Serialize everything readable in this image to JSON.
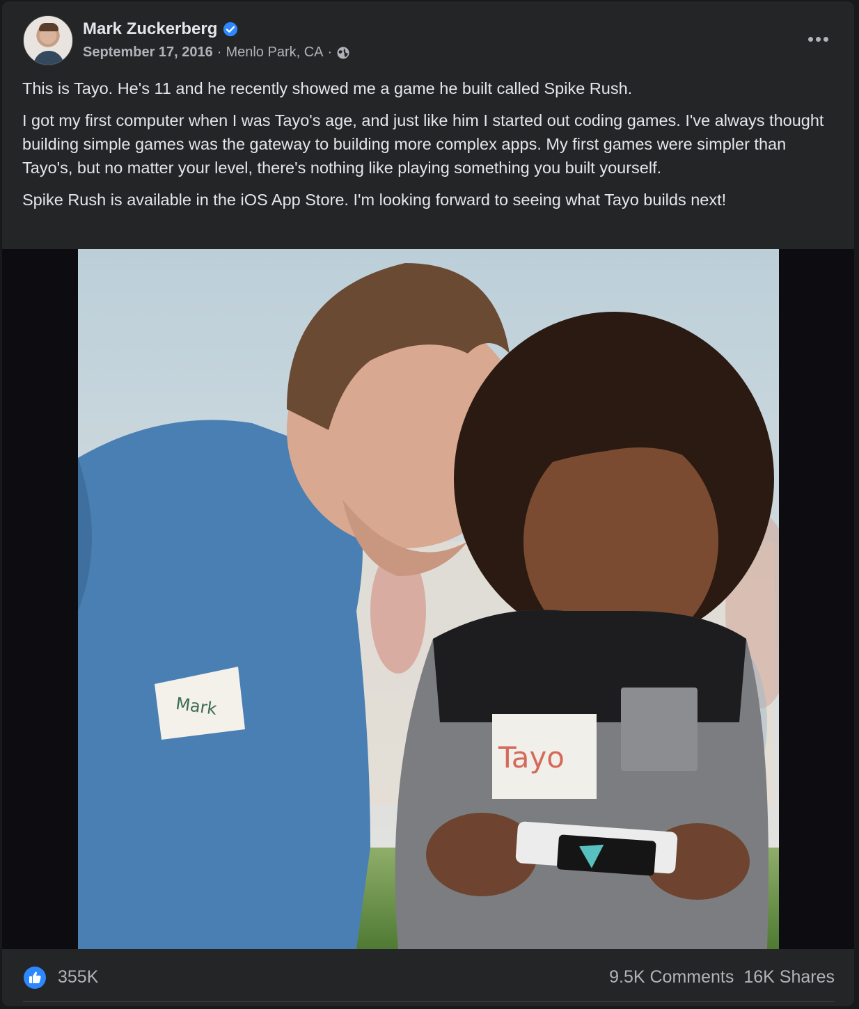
{
  "post": {
    "author": "Mark Zuckerberg",
    "date": "September 17, 2016",
    "location": "Menlo Park, CA",
    "separator": "·",
    "paragraphs": [
      "This is Tayo. He's 11 and he recently showed me a game he built called Spike Rush.",
      "I got my first computer when I was Tayo's age, and just like him I started out coding games. I've always thought building simple games was the gateway to building more complex apps. My first games were simpler than Tayo's, but no matter your level, there's nothing like playing something you built yourself.",
      "Spike Rush is available in the iOS App Store. I'm looking forward to seeing what Tayo builds next!"
    ],
    "photo": {
      "name_tag_left": "Mark",
      "name_tag_right": "Tayo"
    }
  },
  "reactions": {
    "likes": "355K",
    "comments": "9.5K Comments",
    "shares": "16K Shares"
  },
  "colors": {
    "card_bg": "#242526",
    "accent": "#2d88ff"
  },
  "icons": {
    "verified": "verified-badge-icon",
    "audience": "globe-icon",
    "more": "more-options-icon",
    "like": "like-thumb-icon"
  }
}
